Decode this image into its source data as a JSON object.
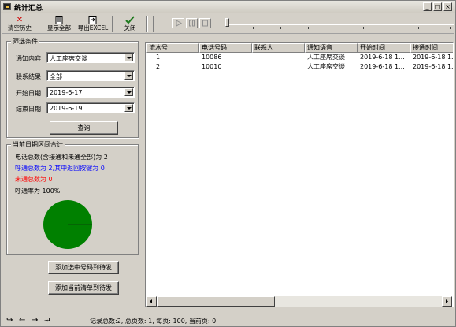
{
  "window": {
    "title": "统计汇总",
    "min": "_",
    "max": "□",
    "close": "×"
  },
  "toolbar": {
    "clear": "清空历史",
    "show_all": "显示全部",
    "export": "导出EXCEL",
    "close": "关闭",
    "icons": {
      "clear": "red-x-icon",
      "show_all": "document-icon",
      "export": "export-icon",
      "close": "checkmark-icon"
    }
  },
  "filter": {
    "group_label": "筛选条件",
    "notify_label": "通知内容",
    "notify_value": "人工座席交谈",
    "result_label": "联系结果",
    "result_value": "全部",
    "start_label": "开始日期",
    "start_value": "2019-6-17",
    "end_label": "结束日期",
    "end_value": "2019-6-19",
    "query_button": "查询"
  },
  "summary": {
    "group_label": "当前日期区间合计",
    "line1": "电话总数(含接通和未通全部)为 2",
    "line2": "呼通总数为 2,其中返回按键为 0",
    "line3": "未通总数为 0",
    "line4": "呼通率为 100%",
    "connected_fraction": 1.0,
    "pie_color": "#008000",
    "line2_color": "#0000ff",
    "line3_color": "#ff0000"
  },
  "actions": {
    "add_selected": "添加选中号码到待发",
    "add_current": "添加当前清单到待发"
  },
  "table": {
    "columns": [
      "流水号",
      "电话号码",
      "联系人",
      "通知语音",
      "开始时间",
      "接通时间"
    ],
    "rows": [
      [
        "1",
        "10086",
        "",
        "人工座席交谈",
        "2019-6-18 1...",
        "2019-6-18 1..."
      ],
      [
        "2",
        "10010",
        "",
        "人工座席交谈",
        "2019-6-18 1...",
        "2019-6-18 1..."
      ]
    ]
  },
  "status": {
    "nav": [
      "↪",
      "←",
      "→",
      "⮒"
    ],
    "text": "记录总数:2, 总页数: 1, 每页: 100, 当前页: 0"
  }
}
